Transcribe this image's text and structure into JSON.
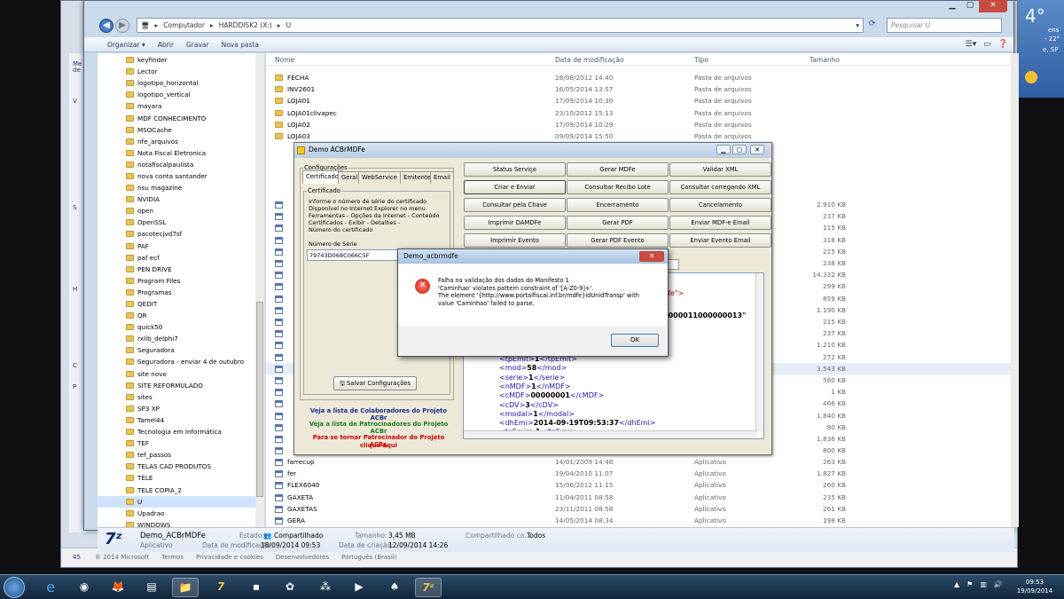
{
  "wallpaper": {
    "temp": "4°",
    "line1": "ens",
    "line2": "- 22°",
    "line3": "e, SP"
  },
  "back_window": {
    "footer_items": [
      "© 2014 Microsoft",
      "Termos",
      "Privacidade e cookies",
      "Desenvolvedores",
      "Português (Brasil)"
    ],
    "left_labels": [
      "Me",
      "de",
      "V",
      "S",
      "H",
      "C",
      "P",
      "45"
    ]
  },
  "explorer": {
    "breadcrumb": [
      "Computador",
      "HARDDISK2 (X:)",
      "U"
    ],
    "search_placeholder": "Pesquisar U",
    "toolbar": [
      "Organizar ▾",
      "Abrir",
      "Gravar",
      "Nova pasta"
    ],
    "columns": {
      "name": "Nome",
      "date": "Data de modificação",
      "type": "Tipo",
      "size": "Tamanho"
    },
    "tree": [
      "keyfinder",
      "Lector",
      "logotipo_horizontal",
      "logotipo_vertical",
      "mayara",
      "MDF CONHECIMENTO",
      "MSOCache",
      "nfe_arquivos",
      "Nota Fiscal Eletronica",
      "notafiscalpaulista",
      "nova conta santander",
      "nsu magazine",
      "NVIDIA",
      "open",
      "OpenSSL",
      "pacotecjvd7sf",
      "PAF",
      "paf ecf",
      "PEN DRIVE",
      "Program Files",
      "Programas",
      "QEDIT",
      "QR",
      "quick50",
      "rxlib_delphi7",
      "Seguradora",
      "Seguradora - enviar 4 de outubro",
      "site novo",
      "SITE REFORMULADO",
      "sites",
      "SP3 XP",
      "Tamel44",
      "Tecnologia em Informática",
      "TEF",
      "tef_passos",
      "TELAS CAD PRODUTOS",
      "TELE",
      "TELE COPIA_2",
      "U",
      "Upadrao",
      "WINDOWS"
    ],
    "files_top": [
      {
        "name": "FECHA",
        "date": "28/08/2012 14:40",
        "type": "Pasta de arquivos",
        "size": ""
      },
      {
        "name": "INV2601",
        "date": "16/05/2014 13:57",
        "type": "Pasta de arquivos",
        "size": ""
      },
      {
        "name": "LOJA01",
        "date": "17/09/2014 10:30",
        "type": "Pasta de arquivos",
        "size": ""
      },
      {
        "name": "LOJA01clivapec",
        "date": "23/10/2012 15:13",
        "type": "Pasta de arquivos",
        "size": ""
      },
      {
        "name": "LOJA02",
        "date": "17/09/2014 10:29",
        "type": "Pasta de arquivos",
        "size": ""
      },
      {
        "name": "LOJA03",
        "date": "09/09/2014 15:50",
        "type": "Pasta de arquivos",
        "size": ""
      }
    ],
    "files_bottom": [
      {
        "name": "farrecup",
        "date": "14/01/2009 14:48",
        "type": "Aplicativo",
        "size": "263 KB"
      },
      {
        "name": "fer",
        "date": "19/04/2010 11:07",
        "type": "Aplicativo",
        "size": "1.827 KB"
      },
      {
        "name": "FLEX6040",
        "date": "15/06/2012 11:15",
        "type": "Aplicativo",
        "size": "260 KB"
      },
      {
        "name": "GAXETA",
        "date": "11/04/2011 08:58",
        "type": "Aplicativo",
        "size": "235 KB"
      },
      {
        "name": "GAXETAS",
        "date": "23/11/2011 08:58",
        "type": "Aplicativo",
        "size": "261 KB"
      },
      {
        "name": "GERA",
        "date": "14/05/2014 08:34",
        "type": "Aplicativo",
        "size": "198 KB"
      }
    ],
    "sizes_middle": [
      "2.910 KB",
      "237 KB",
      "115 KB",
      "318 KB",
      "215 KB",
      "238 KB",
      "14.332 KB",
      "299 KB",
      "859 KB",
      "1.190 KB",
      "215 KB",
      "237 KB",
      "1.210 KB",
      "272 KB",
      "3.543 KB",
      "560 KB",
      "1 KB",
      "466 KB",
      "1.840 KB",
      "80 KB",
      "1.836 KB",
      "800 KB"
    ],
    "details": {
      "name": "Demo_ACBrMDFe",
      "kind": "Aplicativo",
      "state_label": "Estado:",
      "state": "Compartilhado",
      "size_label": "Tamanho:",
      "size": "3,45 MB",
      "modified_label": "Data de modificação:",
      "modified": "18/09/2014 09:53",
      "created_label": "Data de criação:",
      "created": "12/09/2014 14:26",
      "shared_label": "Compartilhado co...",
      "shared": "Todos"
    }
  },
  "acbr": {
    "title": "Demo ACBrMDFe",
    "config_legend": "Configurações",
    "tabs": [
      "Certificado",
      "Geral",
      "WebService",
      "Emitente",
      "Email"
    ],
    "cert_legend": "Certificado",
    "cert_help": "Informe o número de série do certificado\nDisponível no Internet Explorer no menu\nFerramentas - Opções da Internet - Conteúdo\nCertificados - Exibir - Detalhes -\nNúmero do certificado",
    "serial_label": "Número de Série",
    "serial_value": "79743D068C066C5F",
    "save_button": "Salvar Configurações",
    "links": {
      "colab": "Veja a lista de Colaboradores do Projeto ACBr",
      "patro": "Veja a lista de Patrocinadores do Projeto ACBr",
      "become1": "Para se tornar Patrocinador do Projeto ACBr,",
      "become2": "clique aqui"
    },
    "buttons": [
      [
        "Status Serviço",
        "Gerar MDFe",
        "Validar XML"
      ],
      [
        "Criar e Enviar",
        "Consultar Recibo Lote",
        "Consultar carregando XML"
      ],
      [
        "Consultar pela Chave",
        "Encerramento",
        "Cancelamento"
      ],
      [
        "Imprimir DAMDFe",
        "Gerar PDF",
        "Enviar MDF-e Email"
      ],
      [
        "Imprimir Evento",
        "Gerar PDF Evento",
        "Enviar Evento Email"
      ]
    ],
    "xml_partial": [
      "dfe\">",
      "0000011000000013\""
    ],
    "xml_lines": [
      {
        "open": "<tpEmit>",
        "val": "1",
        "close": "</tpEmit>"
      },
      {
        "open": "<mod>",
        "val": "58",
        "close": "</mod>"
      },
      {
        "open": "<serie>",
        "val": "1",
        "close": "</serie>"
      },
      {
        "open": "<nMDF>",
        "val": "1",
        "close": "</nMDF>"
      },
      {
        "open": "<cMDF>",
        "val": "00000001",
        "close": "</cMDF>"
      },
      {
        "open": "<cDV>",
        "val": "3",
        "close": "</cDV>"
      },
      {
        "open": "<modal>",
        "val": "1",
        "close": "</modal>"
      },
      {
        "open": "<dhEmi>",
        "val": "2014-09-19T09:53:37",
        "close": "</dhEmi>"
      },
      {
        "open": "<tpEmis>",
        "val": "1",
        "close": "</tpEmis>"
      }
    ]
  },
  "dialog": {
    "title": "Demo_acbrmdfe",
    "message": "Falha na validação dos dados do Manifesto 1\n'Caminhao' violates pattern constraint of '[A-Z0-9]+'.\nThe element '{http://www.portalfiscal.inf.br/mdfe}idUnidTransp' with\nvalue 'Caminhao' failed to parse.",
    "ok": "OK"
  },
  "taskbar": {
    "time": "09:53",
    "date": "19/09/2014"
  }
}
